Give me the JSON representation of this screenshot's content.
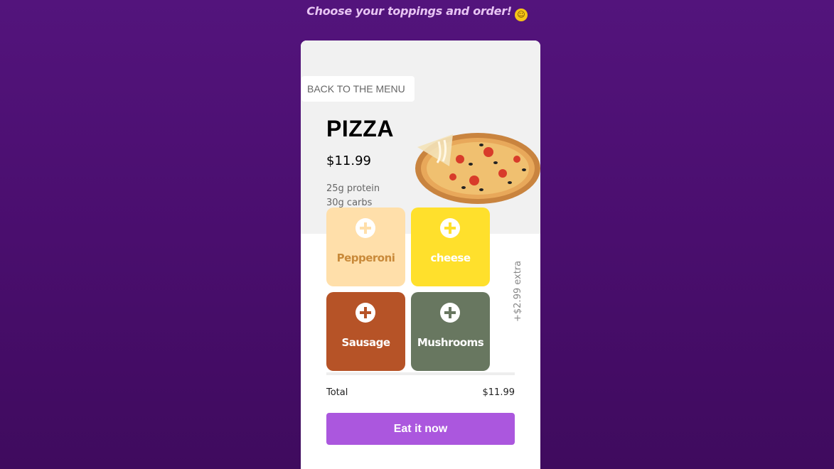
{
  "headline": {
    "text": "Choose your toppings and order!",
    "emoji_icon": "smiling-face-icon"
  },
  "card": {
    "back_button": "BACK TO THE MENU",
    "title": "PIZZA",
    "price": "$11.99",
    "nutrition": {
      "protein": "25g protein",
      "carbs": "30g carbs"
    },
    "toppings": [
      {
        "label": "Pepperoni",
        "bg": "#ffdfaa",
        "fg": "#c98a3a",
        "icon": "plus-circle-icon"
      },
      {
        "label": "cheese",
        "bg": "#ffe02c",
        "fg": "#ffffff",
        "icon": "plus-circle-icon"
      },
      {
        "label": "Sausage",
        "bg": "#b65327",
        "fg": "#ffffff",
        "icon": "plus-circle-icon"
      },
      {
        "label": "Mushrooms",
        "bg": "#687760",
        "fg": "#ffffff",
        "icon": "plus-circle-icon"
      }
    ],
    "extra_note": "+$2.99 extra",
    "total_label": "Total",
    "total_value": "$11.99",
    "order_button": "Eat it now"
  },
  "colors": {
    "accent": "#ab57de",
    "background": "#4a0e6e",
    "headline": "#e7c4f3"
  }
}
